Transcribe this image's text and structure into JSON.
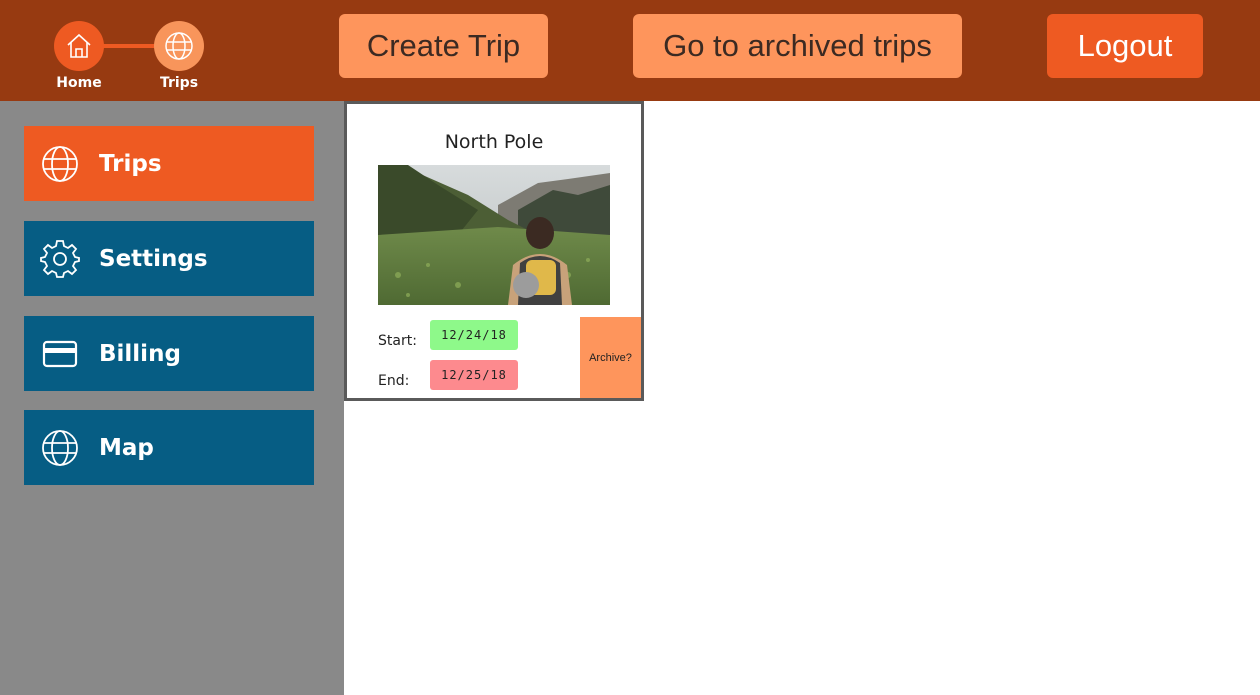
{
  "header": {
    "breadcrumb": [
      {
        "label": "Home",
        "icon": "home-icon"
      },
      {
        "label": "Trips",
        "icon": "globe-icon"
      }
    ],
    "create_trip_label": "Create Trip",
    "archived_trips_label": "Go to archived trips",
    "logout_label": "Logout"
  },
  "sidebar": {
    "items": [
      {
        "label": "Trips",
        "icon": "globe-icon",
        "active": true
      },
      {
        "label": "Settings",
        "icon": "gear-icon",
        "active": false
      },
      {
        "label": "Billing",
        "icon": "credit-card-icon",
        "active": false
      },
      {
        "label": "Map",
        "icon": "globe-icon",
        "active": false
      }
    ]
  },
  "trips": [
    {
      "title": "North Pole",
      "photo": "hiker-with-backpack-in-mountain-meadow",
      "start_label": "Start:",
      "start_date": "12/24/18",
      "end_label": "End:",
      "end_date": "12/25/18",
      "archive_label": "Archive?"
    }
  ],
  "colors": {
    "topbar": "#973a11",
    "accent_orange": "#ee5a22",
    "light_orange": "#fe955c",
    "sidebar_bg": "#898989",
    "sidebar_item": "#065d84",
    "start_date_bg": "#8ef98a",
    "end_date_bg": "#fd8a8e"
  }
}
